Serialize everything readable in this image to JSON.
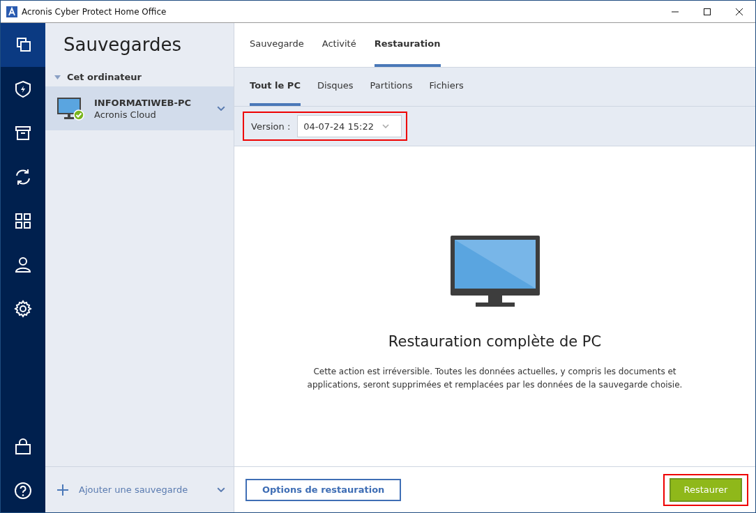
{
  "window": {
    "title": "Acronis Cyber Protect Home Office"
  },
  "nav": {
    "top": [
      {
        "selected": true
      },
      {
        "selected": false
      },
      {
        "selected": false
      },
      {
        "selected": false
      },
      {
        "selected": false
      },
      {
        "selected": false
      },
      {
        "selected": false
      }
    ],
    "bottom": [
      {
        "selected": false
      },
      {
        "selected": false
      }
    ]
  },
  "sidebar": {
    "title": "Sauvegardes",
    "group": {
      "label": "Cet ordinateur",
      "expanded": true
    },
    "items": [
      {
        "name": "INFORMATIWEB-PC",
        "destination": "Acronis Cloud",
        "selected": true,
        "backed_up": true
      }
    ],
    "add_label": "Ajouter une sauvegarde"
  },
  "tabs": [
    {
      "label": "Sauvegarde",
      "selected": false
    },
    {
      "label": "Activité",
      "selected": false
    },
    {
      "label": "Restauration",
      "selected": true
    }
  ],
  "subtabs": [
    {
      "label": "Tout le PC",
      "selected": true
    },
    {
      "label": "Disques",
      "selected": false
    },
    {
      "label": "Partitions",
      "selected": false
    },
    {
      "label": "Fichiers",
      "selected": false
    }
  ],
  "version": {
    "label": "Version :",
    "value": "04-07-24 15:22",
    "highlighted": true
  },
  "content": {
    "title": "Restauration complète de PC",
    "description": "Cette action est irréversible. Toutes les données actuelles, y compris les documents et applications, seront supprimées et remplacées par les données de la sauvegarde choisie."
  },
  "footer": {
    "options_button": "Options de restauration",
    "restore_button": {
      "label": "Restaurer",
      "highlighted": true
    }
  }
}
